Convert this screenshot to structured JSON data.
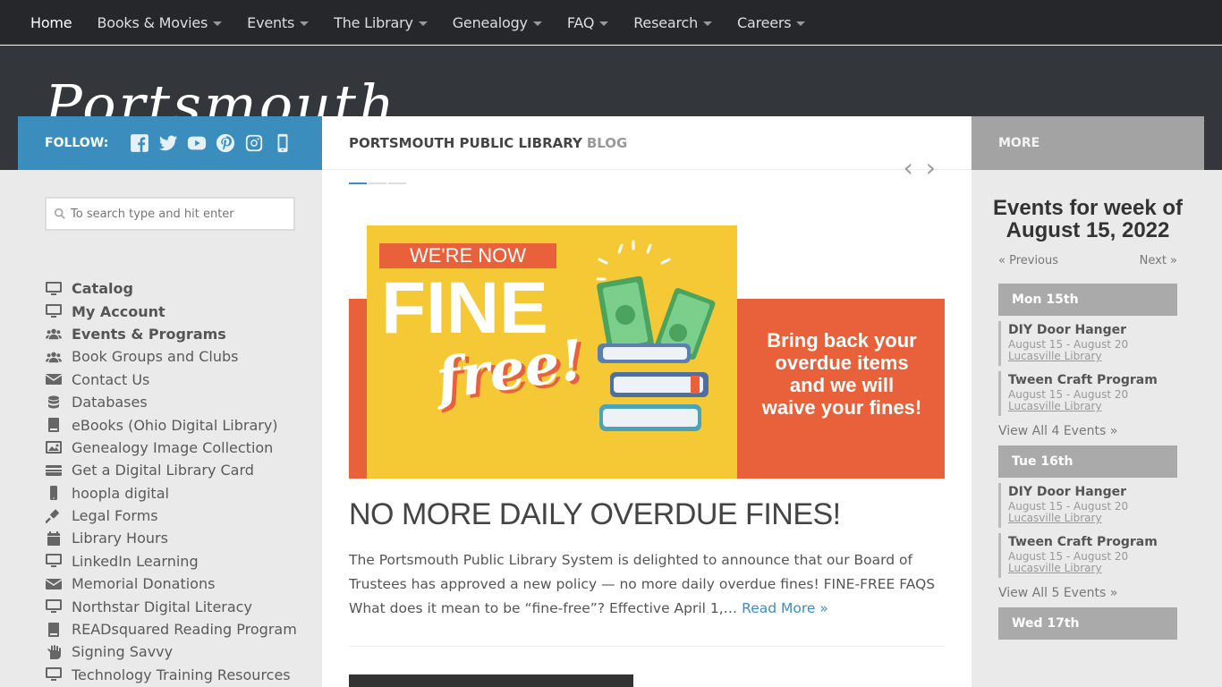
{
  "nav": {
    "items": [
      {
        "label": "Home",
        "dropdown": false
      },
      {
        "label": "Books & Movies",
        "dropdown": true
      },
      {
        "label": "Events",
        "dropdown": true
      },
      {
        "label": "The Library",
        "dropdown": true
      },
      {
        "label": "Genealogy",
        "dropdown": true
      },
      {
        "label": "FAQ",
        "dropdown": true
      },
      {
        "label": "Research",
        "dropdown": true
      },
      {
        "label": "Careers",
        "dropdown": true
      }
    ]
  },
  "header": {
    "logo_text": "Portsmouth"
  },
  "follow": {
    "label": "FOLLOW:",
    "icons": [
      "facebook-icon",
      "twitter-icon",
      "youtube-icon",
      "pinterest-icon",
      "instagram-icon",
      "mobile-icon"
    ]
  },
  "search": {
    "placeholder": "To search type and hit enter"
  },
  "links": [
    {
      "label": "Catalog",
      "icon": "desktop-icon",
      "bold": true
    },
    {
      "label": "My Account",
      "icon": "desktop-icon",
      "bold": true
    },
    {
      "label": "Events & Programs",
      "icon": "users-icon",
      "bold": true
    },
    {
      "label": "Book Groups and Clubs",
      "icon": "users-icon",
      "bold": false
    },
    {
      "label": "Contact Us",
      "icon": "envelope-icon",
      "bold": false
    },
    {
      "label": "Databases",
      "icon": "database-icon",
      "bold": false
    },
    {
      "label": "eBooks (Ohio Digital Library)",
      "icon": "book-icon",
      "bold": false
    },
    {
      "label": "Genealogy Image Collection",
      "icon": "image-icon",
      "bold": false
    },
    {
      "label": "Get a Digital Library Card",
      "icon": "card-icon",
      "bold": false
    },
    {
      "label": "hoopla digital",
      "icon": "mobile-icon",
      "bold": false
    },
    {
      "label": "Legal Forms",
      "icon": "gavel-icon",
      "bold": false
    },
    {
      "label": "Library Hours",
      "icon": "calendar-icon",
      "bold": false
    },
    {
      "label": "LinkedIn Learning",
      "icon": "desktop-icon",
      "bold": false
    },
    {
      "label": "Memorial Donations",
      "icon": "envelope-icon",
      "bold": false
    },
    {
      "label": "Northstar Digital Literacy",
      "icon": "desktop-icon",
      "bold": false
    },
    {
      "label": "READsquared Reading Program",
      "icon": "book-icon",
      "bold": false
    },
    {
      "label": "Signing Savvy",
      "icon": "hand-icon",
      "bold": false
    },
    {
      "label": "Technology Training Resources",
      "icon": "desktop-icon",
      "bold": false
    }
  ],
  "main": {
    "heading_a": "PORTSMOUTH PUBLIC LIBRARY",
    "heading_b": "BLOG",
    "banner": {
      "line1": "WE'RE NOW",
      "line2": "FINE",
      "line3": "free!",
      "right_text": [
        "Bring back your",
        "overdue items",
        "and we will",
        "waive your fines!"
      ],
      "colors": {
        "yellow": "#f5c935",
        "orange": "#e8613a",
        "green": "#5bb56d",
        "white": "#ffffff"
      }
    },
    "post_title": "NO MORE DAILY OVERDUE FINES!",
    "excerpt": "The Portsmouth Public Library System is delighted to announce that our Board of Trustees has approved a new policy — no more daily overdue fines!  FINE-FREE FAQS What does it mean to be “fine-free”? Effective April 1,…",
    "read_more": "Read More »"
  },
  "right": {
    "more_label": "MORE",
    "events_title": "Events for week of August 15, 2022",
    "prev": "« Previous",
    "next": "Next »",
    "days": [
      {
        "label": "Mon 15th",
        "events": [
          {
            "name": "DIY Door Hanger",
            "dates": "August 15 - August 20",
            "location": "Lucasville Library"
          },
          {
            "name": "Tween Craft Program",
            "dates": "August 15 - August 20",
            "location": "Lucasville Library"
          }
        ],
        "view_all": "View All 4 Events »"
      },
      {
        "label": "Tue 16th",
        "events": [
          {
            "name": "DIY Door Hanger",
            "dates": "August 15 - August 20",
            "location": "Lucasville Library"
          },
          {
            "name": "Tween Craft Program",
            "dates": "August 15 - August 20",
            "location": "Lucasville Library"
          }
        ],
        "view_all": "View All 5 Events »"
      },
      {
        "label": "Wed 17th",
        "events": [],
        "view_all": ""
      }
    ]
  },
  "colors": {
    "nav_bg": "#26272b",
    "accent_blue": "#3b8dbd",
    "more_gray": "#a3a3a3"
  }
}
